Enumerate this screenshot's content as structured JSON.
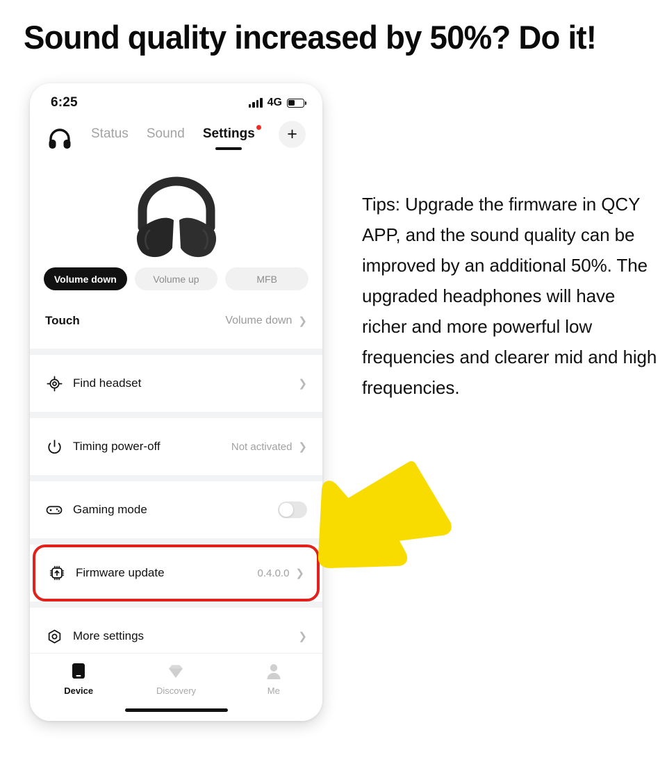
{
  "headline": "Sound quality increased by 50%? Do it!",
  "phone": {
    "status_bar": {
      "time": "6:25",
      "network": "4G",
      "signal_icon": "signal-bars-icon",
      "battery_icon": "battery-icon"
    },
    "header": {
      "brand_icon": "headphones-icon",
      "tabs": [
        {
          "label": "Status",
          "active": false
        },
        {
          "label": "Sound",
          "active": false
        },
        {
          "label": "Settings",
          "active": true,
          "badge": true
        }
      ],
      "add_button": "+"
    },
    "hero_icon": "over-ear-headphones-image",
    "chips": [
      {
        "label": "Volume down",
        "active": true
      },
      {
        "label": "Volume up",
        "active": false
      },
      {
        "label": "MFB",
        "active": false
      }
    ],
    "touch": {
      "label": "Touch",
      "value": "Volume down"
    },
    "rows": [
      {
        "icon": "target-icon",
        "title": "Find headset",
        "value": "",
        "control": "chevron"
      },
      {
        "icon": "power-icon",
        "title": "Timing power-off",
        "value": "Not activated",
        "control": "chevron"
      },
      {
        "icon": "gamepad-icon",
        "title": "Gaming mode",
        "value": "",
        "control": "toggle-off"
      },
      {
        "icon": "firmware-update-icon",
        "title": "Firmware update",
        "value": "0.4.0.0",
        "control": "chevron",
        "highlighted": true
      },
      {
        "icon": "nut-settings-icon",
        "title": "More settings",
        "value": "",
        "control": "chevron"
      }
    ],
    "bottom_nav": [
      {
        "label": "Device",
        "icon": "phone-icon",
        "active": true
      },
      {
        "label": "Discovery",
        "icon": "diamond-icon",
        "active": false
      },
      {
        "label": "Me",
        "icon": "person-icon",
        "active": false
      }
    ]
  },
  "tips": "Tips: Upgrade the firmware in QCY APP, and the sound quality can be improved by an additional 50%. The upgraded headphones will have richer and more powerful low frequencies and clearer mid and high frequencies.",
  "colors": {
    "accent_red": "#e3211c",
    "arrow_yellow": "#f8dc00",
    "badge_red": "#ef2b24",
    "text_primary": "#111111",
    "text_muted": "#a1a1a1"
  }
}
